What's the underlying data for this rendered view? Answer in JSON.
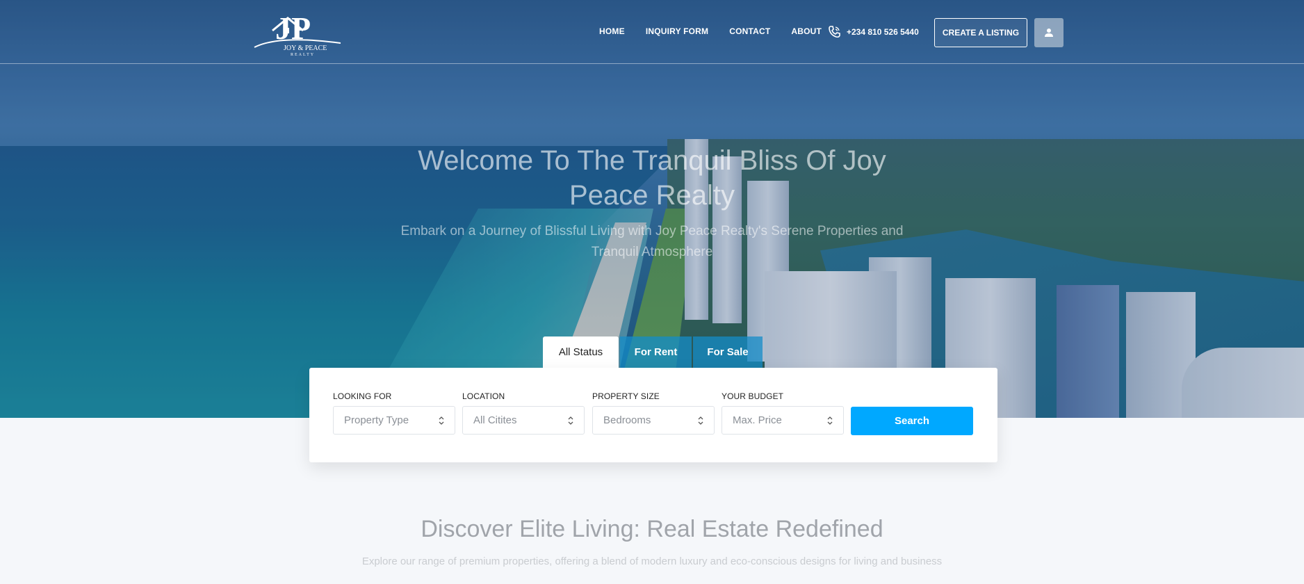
{
  "brand": {
    "logo_monogram": "JP",
    "logo_name": "JOY & PEACE",
    "logo_tagline": "REALTY"
  },
  "nav": {
    "items": [
      "HOME",
      "INQUIRY FORM",
      "CONTACT",
      "ABOUT"
    ],
    "phone": "+234 810 526 5440",
    "cta_label": "CREATE A LISTING",
    "phone_icon": "phone-icon",
    "user_icon": "user-icon"
  },
  "hero": {
    "title": "Welcome To The Tranquil Bliss Of Joy Peace Realty",
    "subtitle": "Embark on a Journey of Blissful Living with Joy Peace Realty's Serene Properties and Tranquil Atmosphere"
  },
  "tabs": [
    {
      "label": "All Status",
      "active": true
    },
    {
      "label": "For Rent",
      "active": false
    },
    {
      "label": "For Sale",
      "active": false
    }
  ],
  "search": {
    "fields": [
      {
        "label": "LOOKING FOR",
        "value": "Property Type"
      },
      {
        "label": "LOCATION",
        "value": "All Citites"
      },
      {
        "label": "PROPERTY SIZE",
        "value": "Bedrooms"
      },
      {
        "label": "YOUR BUDGET",
        "value": "Max. Price"
      }
    ],
    "button_label": "Search"
  },
  "section": {
    "title": "Discover Elite Living: Real Estate Redefined",
    "subtitle": "Explore our range of premium properties, offering a blend of modern luxury and eco-conscious designs for living and business"
  },
  "colors": {
    "accent": "#00a8ff",
    "tab_inactive": "#148cc8",
    "page_bg": "#f5f7fa"
  }
}
